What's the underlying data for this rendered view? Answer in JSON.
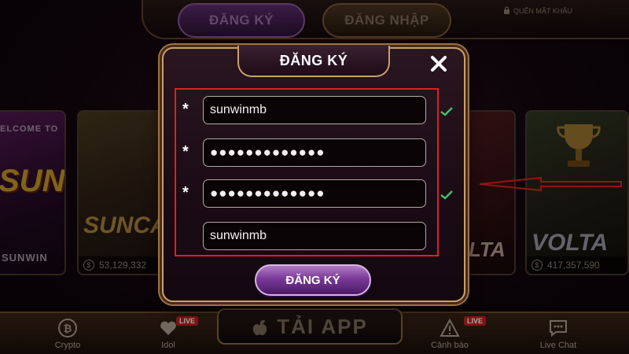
{
  "topbar": {
    "register_tab": "ĐĂNG KÝ",
    "login_tab": "ĐĂNG NHẬP",
    "forgot_password": "QUÊN MẬT KHẨU"
  },
  "games": {
    "card1": {
      "welcome": "ELCOME TO",
      "logo": "SUN",
      "name": "SUNWIN"
    },
    "card2": {
      "logo": "SUNCA",
      "jackpot": "53,129,332"
    },
    "card3": {
      "logo": "LTA"
    },
    "card4": {
      "logo": "VOLTA",
      "jackpot": "417,357,590"
    }
  },
  "bottom_bar": {
    "crypto": "Crypto",
    "idol": "Idol",
    "live_tag": "LIVE",
    "download_app": "TẢI APP",
    "warning": "Cảnh báo",
    "live_chat": "Live Chat"
  },
  "modal": {
    "title": "ĐĂNG KÝ",
    "required_mark": "*",
    "username": "sunwinmb",
    "password": "●●●●●●●●●●●●●",
    "confirm_password": "●●●●●●●●●●●●●",
    "display_name": "sunwinmb",
    "submit": "ĐĂNG KÝ"
  },
  "colors": {
    "accent_purple": "#7a3a98",
    "frame_gold": "#c8a06a",
    "highlight_red": "#e0201e",
    "check_green": "#3fbf6a"
  }
}
